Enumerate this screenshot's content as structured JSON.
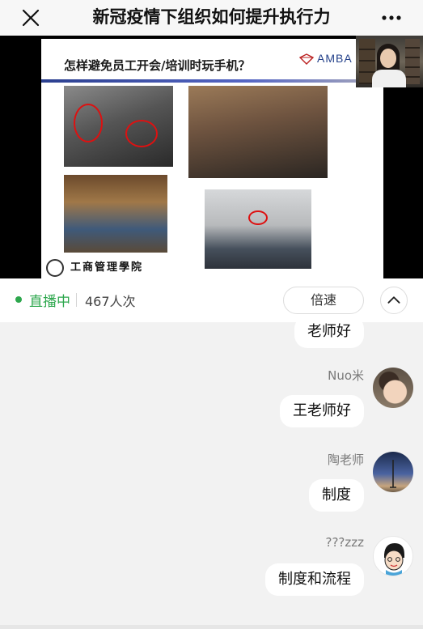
{
  "header": {
    "title": "新冠疫情下组织如何提升执行力",
    "close_icon": "close-icon",
    "more_icon": "more-icon"
  },
  "video": {
    "slide_title": "怎样避免员工开会/培训时玩手机？",
    "amba_logo_text": "AMBA",
    "school_logo_text": "工商管理學院"
  },
  "status": {
    "live_label": "直播中",
    "viewers": "467人次",
    "speed_label": "倍速",
    "live_color": "#2da74d"
  },
  "chat": {
    "messages": [
      {
        "name": "",
        "text": "老师好"
      },
      {
        "name": "Nuo米",
        "text": "王老师好"
      },
      {
        "name": "陶老师",
        "text": "制度"
      },
      {
        "name": "???zzz",
        "text": "制度和流程"
      }
    ]
  }
}
